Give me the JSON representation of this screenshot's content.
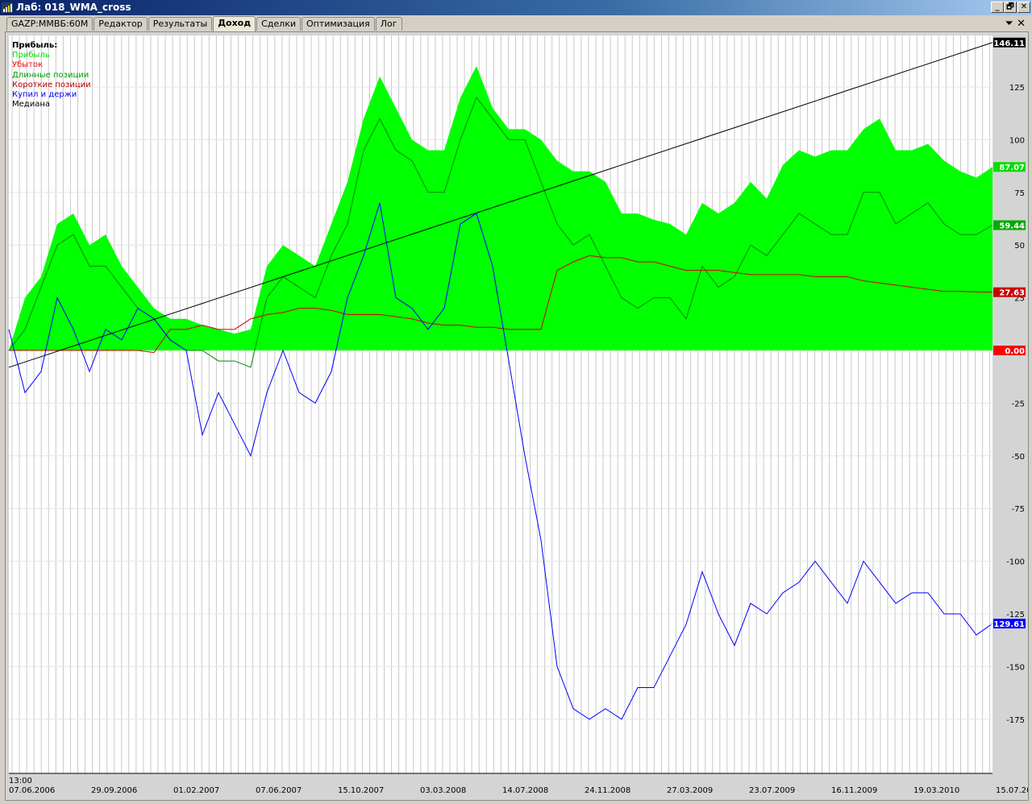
{
  "window": {
    "title": "Лаб: 018_WMA_cross",
    "minimize": "_",
    "restore": "🗗",
    "close": "✕"
  },
  "tabs": [
    {
      "label": "GAZP:MMBБ:60M"
    },
    {
      "label": "Редактор"
    },
    {
      "label": "Результаты"
    },
    {
      "label": "Доход",
      "active": true
    },
    {
      "label": "Сделки"
    },
    {
      "label": "Оптимизация"
    },
    {
      "label": "Лог"
    }
  ],
  "tab_controls": {
    "menu": "⏷",
    "close": "✕"
  },
  "legend": {
    "title": "Прибыль:",
    "items": [
      {
        "label": "Прибыль",
        "color": "#00e000"
      },
      {
        "label": "Убыток",
        "color": "#ff0000"
      },
      {
        "label": "Длинные позиции",
        "color": "#009900"
      },
      {
        "label": "Короткие позиции",
        "color": "#bb0000"
      },
      {
        "label": "Купил и держи",
        "color": "#0000ff"
      },
      {
        "label": "Медиана",
        "color": "#000000"
      }
    ]
  },
  "chart_data": {
    "type": "line",
    "title": "Прибыль",
    "time_label": "13:00",
    "x_ticks": [
      "07.06.2006",
      "29.09.2006",
      "01.02.2007",
      "07.06.2007",
      "15.10.2007",
      "03.03.2008",
      "14.07.2008",
      "24.11.2008",
      "27.03.2009",
      "23.07.2009",
      "16.11.2009",
      "19.03.2010",
      "15.07.20"
    ],
    "y_ticks": [
      125,
      100,
      75,
      50,
      25,
      0,
      -25,
      -50,
      -75,
      -100,
      -125,
      -150,
      -175
    ],
    "ylim": [
      -197,
      146
    ],
    "grid": true,
    "series": [
      {
        "name": "Прибыль",
        "kind": "area",
        "color": "#00ff00",
        "last": "87.07",
        "values": [
          0,
          25,
          35,
          60,
          65,
          50,
          55,
          40,
          30,
          20,
          15,
          15,
          12,
          10,
          8,
          10,
          40,
          50,
          45,
          40,
          60,
          80,
          110,
          130,
          115,
          100,
          95,
          95,
          120,
          135,
          115,
          105,
          105,
          100,
          90,
          85,
          85,
          80,
          65,
          65,
          62,
          60,
          55,
          70,
          65,
          70,
          80,
          72,
          88,
          95,
          92,
          95,
          95,
          105,
          110,
          95,
          95,
          98,
          90,
          85,
          82,
          87.07
        ]
      },
      {
        "name": "Длинные позиции",
        "kind": "line",
        "color": "#008800",
        "last": "59.44",
        "values": [
          0,
          10,
          30,
          50,
          55,
          40,
          40,
          30,
          20,
          15,
          5,
          0,
          0,
          -5,
          -5,
          -8,
          25,
          35,
          30,
          25,
          45,
          60,
          95,
          110,
          95,
          90,
          75,
          75,
          100,
          120,
          110,
          100,
          100,
          80,
          60,
          50,
          55,
          40,
          25,
          20,
          25,
          25,
          15,
          40,
          30,
          35,
          50,
          45,
          55,
          65,
          60,
          55,
          55,
          75,
          75,
          60,
          65,
          70,
          60,
          55,
          55,
          59.44
        ]
      },
      {
        "name": "Короткие позиции",
        "kind": "line",
        "color": "#cc0000",
        "last": "27.63",
        "values": [
          0,
          0,
          0,
          0,
          0,
          0,
          0,
          0,
          0,
          -1,
          10,
          10,
          12,
          10,
          10,
          15,
          17,
          18,
          20,
          20,
          19,
          17,
          17,
          17,
          16,
          15,
          13,
          12,
          12,
          11,
          11,
          10,
          10,
          10,
          38,
          42,
          45,
          44,
          44,
          42,
          42,
          40,
          38,
          38,
          38,
          37,
          36,
          36,
          36,
          36,
          35,
          35,
          35,
          33,
          32,
          31,
          30,
          29,
          28,
          28,
          27.8,
          27.63
        ]
      },
      {
        "name": "Купил и держи",
        "kind": "line",
        "color": "#0000ff",
        "last": "-129.61",
        "values": [
          10,
          -20,
          -10,
          25,
          10,
          -10,
          10,
          5,
          20,
          15,
          5,
          0,
          -40,
          -20,
          -35,
          -50,
          -20,
          0,
          -20,
          -25,
          -10,
          25,
          45,
          70,
          25,
          20,
          10,
          20,
          60,
          65,
          40,
          -5,
          -50,
          -90,
          -150,
          -170,
          -175,
          -170,
          -175,
          -160,
          -160,
          -145,
          -130,
          -105,
          -125,
          -140,
          -120,
          -125,
          -115,
          -110,
          -100,
          -110,
          -120,
          -100,
          -110,
          -120,
          -115,
          -115,
          -125,
          -125,
          -135,
          -129.61
        ]
      },
      {
        "name": "Медиана",
        "kind": "line",
        "color": "#000000",
        "last": "146.11",
        "values": [
          -8,
          146.11
        ]
      },
      {
        "name": "zero",
        "kind": "marker",
        "color": "#ff0000",
        "last": "0.00",
        "values": [
          0
        ]
      }
    ]
  }
}
